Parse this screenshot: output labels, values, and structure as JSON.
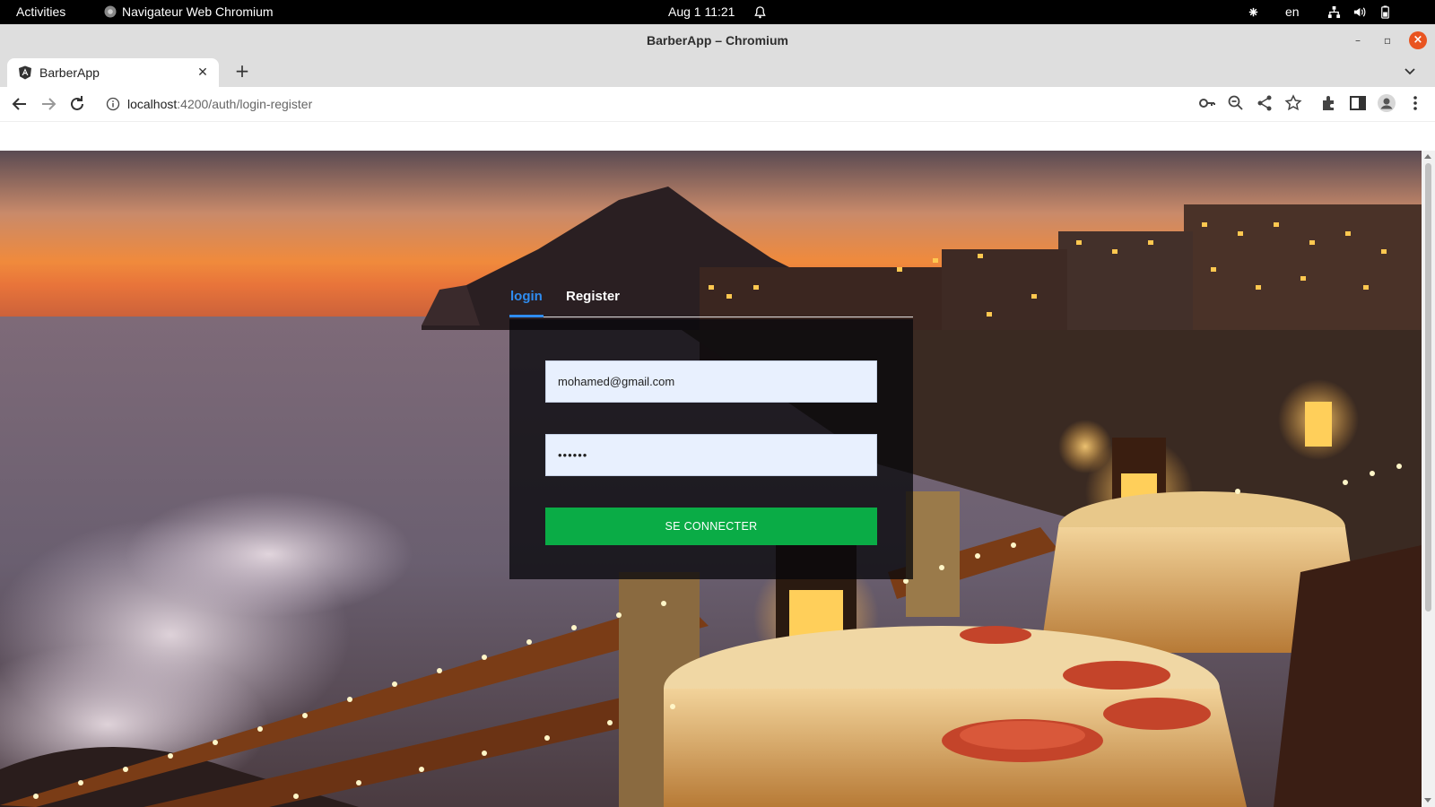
{
  "system_bar": {
    "activities": "Activities",
    "app_name": "Navigateur Web Chromium",
    "datetime": "Aug 1  11:21",
    "language": "en"
  },
  "window": {
    "title": "BarberApp – Chromium"
  },
  "browser": {
    "tab_title": "BarberApp",
    "url_host": "localhost",
    "url_path": ":4200/auth/login-register"
  },
  "auth": {
    "tabs": [
      {
        "label": "login",
        "active": true
      },
      {
        "label": "Register",
        "active": false
      }
    ],
    "email_value": "mohamed@gmail.com",
    "password_mask": "••••••",
    "submit_label": "SE CONNECTER"
  },
  "colors": {
    "accent": "#2f8cf0",
    "submit": "#0aac46",
    "input_bg": "#e8f0fe",
    "close_button": "#e95420"
  },
  "icons": {
    "tab_favicon": "angular-icon",
    "site_info": "info-icon",
    "toolbar": [
      "key-icon",
      "zoom-icon",
      "share-icon",
      "star-icon",
      "extensions-icon",
      "side-panel-icon",
      "profile-icon",
      "menu-icon"
    ]
  }
}
